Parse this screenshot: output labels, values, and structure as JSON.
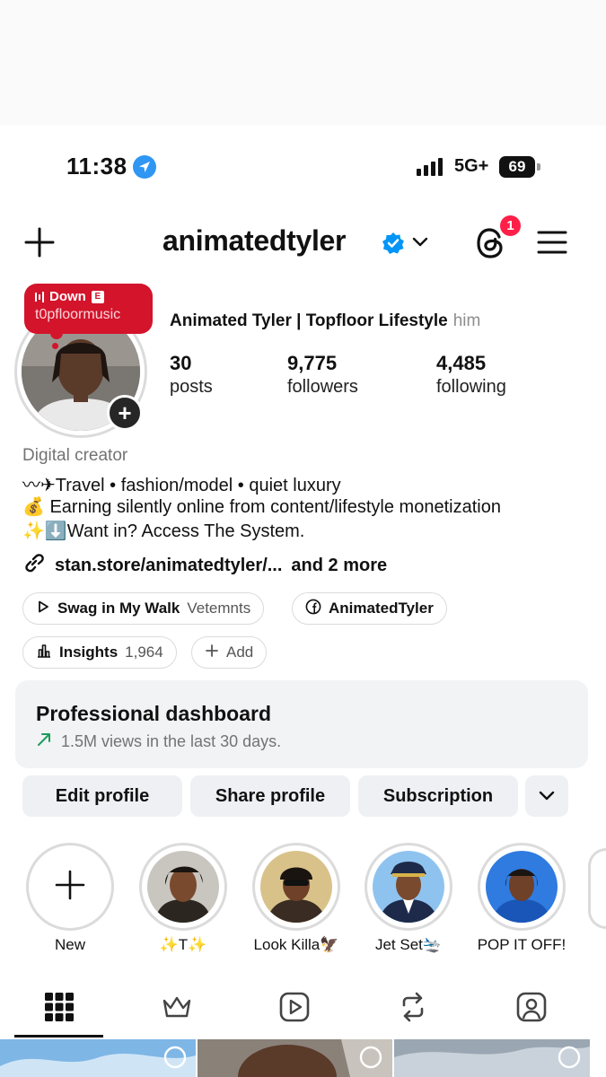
{
  "status_bar": {
    "time": "11:38",
    "network": "5G+",
    "battery": "69"
  },
  "header": {
    "username": "animatedtyler",
    "notification_count": "1"
  },
  "note": {
    "song": "Down",
    "explicit": "E",
    "artist": "t0pfloormusic"
  },
  "profile": {
    "full_name": "Animated Tyler | Topfloor Lifestyle",
    "pronouns": "him",
    "stats": [
      {
        "value": "30",
        "label": "posts"
      },
      {
        "value": "9,775",
        "label": "followers"
      },
      {
        "value": "4,485",
        "label": "following"
      }
    ]
  },
  "bio": {
    "category": "Digital creator",
    "lines": [
      "〰✈Travel • fashion/model • quiet luxury",
      "💰 Earning silently online from content/lifestyle monetization",
      "✨⬇️Want in? Access The System."
    ],
    "link": "stan.store/animatedtyler/...",
    "link_more": "and 2 more"
  },
  "chips": {
    "music_title": "Swag in My Walk",
    "music_artist": "Vetemnts",
    "facebook": "AnimatedTyler",
    "insights_label": "Insights",
    "insights_count": "1,964",
    "add_label": "Add"
  },
  "dashboard": {
    "title": "Professional dashboard",
    "subtitle": "1.5M views in the last 30 days."
  },
  "buttons": {
    "edit": "Edit profile",
    "share": "Share profile",
    "subscription": "Subscription"
  },
  "highlights": [
    {
      "label": "New"
    },
    {
      "label": "✨T✨"
    },
    {
      "label": "Look Killa🦅"
    },
    {
      "label": "Jet Set🛬"
    },
    {
      "label": "POP IT OFF!"
    }
  ],
  "tabs": [
    "grid",
    "subscriptions",
    "reels",
    "reposts",
    "tagged"
  ],
  "colors": {
    "accent_blue": "#0095f6",
    "notification_red": "#ff1f48",
    "note_red": "#d3142b",
    "growth_green": "#1a9e5b"
  }
}
